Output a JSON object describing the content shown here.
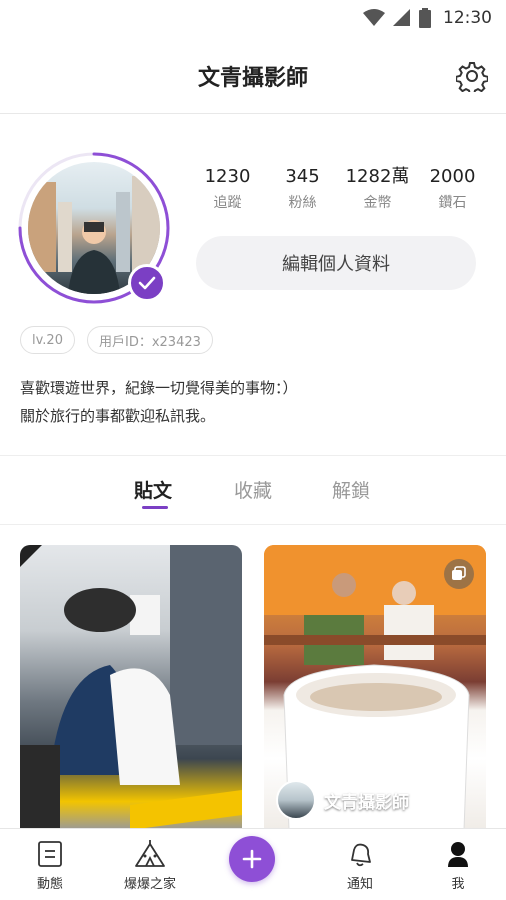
{
  "status_bar": {
    "time": "12:30"
  },
  "header": {
    "title": "文青攝影師"
  },
  "profile": {
    "stats": [
      {
        "value": "1230",
        "label": "追蹤"
      },
      {
        "value": "345",
        "label": "粉絲"
      },
      {
        "value": "1282萬",
        "label": "金幣"
      },
      {
        "value": "2000",
        "label": "鑽石"
      }
    ],
    "edit_button": "編輯個人資料",
    "level_chip": "lv.20",
    "user_id_chip": "用戶ID：x23423",
    "bio_line1": "喜歡環遊世界，紀錄一切覺得美的事物：）",
    "bio_line2": "關於旅行的事都歡迎私訊我。"
  },
  "tabs": [
    {
      "label": "貼文",
      "active": true
    },
    {
      "label": "收藏",
      "active": false
    },
    {
      "label": "解鎖",
      "active": false
    }
  ],
  "posts": [
    {
      "author": ""
    },
    {
      "author": "文青攝影師"
    }
  ],
  "bottom_nav": {
    "items": [
      {
        "label": "動態",
        "icon": "feed-icon"
      },
      {
        "label": "爆爆之家",
        "icon": "tent-icon"
      },
      {
        "label": "通知",
        "icon": "bell-icon"
      },
      {
        "label": "我",
        "icon": "person-icon"
      }
    ],
    "fab_icon": "plus-icon"
  },
  "colors": {
    "accent": "#7b3fc4",
    "fab": "#8e4fd6"
  }
}
